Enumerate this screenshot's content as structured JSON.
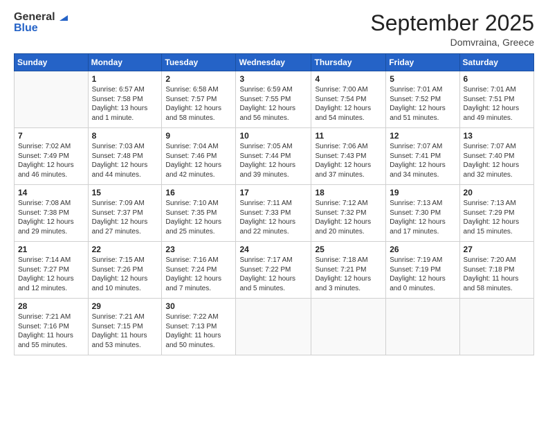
{
  "logo": {
    "general": "General",
    "blue": "Blue"
  },
  "header": {
    "month": "September 2025",
    "location": "Domvraina, Greece"
  },
  "weekdays": [
    "Sunday",
    "Monday",
    "Tuesday",
    "Wednesday",
    "Thursday",
    "Friday",
    "Saturday"
  ],
  "weeks": [
    [
      {
        "day": "",
        "info": ""
      },
      {
        "day": "1",
        "info": "Sunrise: 6:57 AM\nSunset: 7:58 PM\nDaylight: 13 hours\nand 1 minute."
      },
      {
        "day": "2",
        "info": "Sunrise: 6:58 AM\nSunset: 7:57 PM\nDaylight: 12 hours\nand 58 minutes."
      },
      {
        "day": "3",
        "info": "Sunrise: 6:59 AM\nSunset: 7:55 PM\nDaylight: 12 hours\nand 56 minutes."
      },
      {
        "day": "4",
        "info": "Sunrise: 7:00 AM\nSunset: 7:54 PM\nDaylight: 12 hours\nand 54 minutes."
      },
      {
        "day": "5",
        "info": "Sunrise: 7:01 AM\nSunset: 7:52 PM\nDaylight: 12 hours\nand 51 minutes."
      },
      {
        "day": "6",
        "info": "Sunrise: 7:01 AM\nSunset: 7:51 PM\nDaylight: 12 hours\nand 49 minutes."
      }
    ],
    [
      {
        "day": "7",
        "info": "Sunrise: 7:02 AM\nSunset: 7:49 PM\nDaylight: 12 hours\nand 46 minutes."
      },
      {
        "day": "8",
        "info": "Sunrise: 7:03 AM\nSunset: 7:48 PM\nDaylight: 12 hours\nand 44 minutes."
      },
      {
        "day": "9",
        "info": "Sunrise: 7:04 AM\nSunset: 7:46 PM\nDaylight: 12 hours\nand 42 minutes."
      },
      {
        "day": "10",
        "info": "Sunrise: 7:05 AM\nSunset: 7:44 PM\nDaylight: 12 hours\nand 39 minutes."
      },
      {
        "day": "11",
        "info": "Sunrise: 7:06 AM\nSunset: 7:43 PM\nDaylight: 12 hours\nand 37 minutes."
      },
      {
        "day": "12",
        "info": "Sunrise: 7:07 AM\nSunset: 7:41 PM\nDaylight: 12 hours\nand 34 minutes."
      },
      {
        "day": "13",
        "info": "Sunrise: 7:07 AM\nSunset: 7:40 PM\nDaylight: 12 hours\nand 32 minutes."
      }
    ],
    [
      {
        "day": "14",
        "info": "Sunrise: 7:08 AM\nSunset: 7:38 PM\nDaylight: 12 hours\nand 29 minutes."
      },
      {
        "day": "15",
        "info": "Sunrise: 7:09 AM\nSunset: 7:37 PM\nDaylight: 12 hours\nand 27 minutes."
      },
      {
        "day": "16",
        "info": "Sunrise: 7:10 AM\nSunset: 7:35 PM\nDaylight: 12 hours\nand 25 minutes."
      },
      {
        "day": "17",
        "info": "Sunrise: 7:11 AM\nSunset: 7:33 PM\nDaylight: 12 hours\nand 22 minutes."
      },
      {
        "day": "18",
        "info": "Sunrise: 7:12 AM\nSunset: 7:32 PM\nDaylight: 12 hours\nand 20 minutes."
      },
      {
        "day": "19",
        "info": "Sunrise: 7:13 AM\nSunset: 7:30 PM\nDaylight: 12 hours\nand 17 minutes."
      },
      {
        "day": "20",
        "info": "Sunrise: 7:13 AM\nSunset: 7:29 PM\nDaylight: 12 hours\nand 15 minutes."
      }
    ],
    [
      {
        "day": "21",
        "info": "Sunrise: 7:14 AM\nSunset: 7:27 PM\nDaylight: 12 hours\nand 12 minutes."
      },
      {
        "day": "22",
        "info": "Sunrise: 7:15 AM\nSunset: 7:26 PM\nDaylight: 12 hours\nand 10 minutes."
      },
      {
        "day": "23",
        "info": "Sunrise: 7:16 AM\nSunset: 7:24 PM\nDaylight: 12 hours\nand 7 minutes."
      },
      {
        "day": "24",
        "info": "Sunrise: 7:17 AM\nSunset: 7:22 PM\nDaylight: 12 hours\nand 5 minutes."
      },
      {
        "day": "25",
        "info": "Sunrise: 7:18 AM\nSunset: 7:21 PM\nDaylight: 12 hours\nand 3 minutes."
      },
      {
        "day": "26",
        "info": "Sunrise: 7:19 AM\nSunset: 7:19 PM\nDaylight: 12 hours\nand 0 minutes."
      },
      {
        "day": "27",
        "info": "Sunrise: 7:20 AM\nSunset: 7:18 PM\nDaylight: 11 hours\nand 58 minutes."
      }
    ],
    [
      {
        "day": "28",
        "info": "Sunrise: 7:21 AM\nSunset: 7:16 PM\nDaylight: 11 hours\nand 55 minutes."
      },
      {
        "day": "29",
        "info": "Sunrise: 7:21 AM\nSunset: 7:15 PM\nDaylight: 11 hours\nand 53 minutes."
      },
      {
        "day": "30",
        "info": "Sunrise: 7:22 AM\nSunset: 7:13 PM\nDaylight: 11 hours\nand 50 minutes."
      },
      {
        "day": "",
        "info": ""
      },
      {
        "day": "",
        "info": ""
      },
      {
        "day": "",
        "info": ""
      },
      {
        "day": "",
        "info": ""
      }
    ]
  ]
}
